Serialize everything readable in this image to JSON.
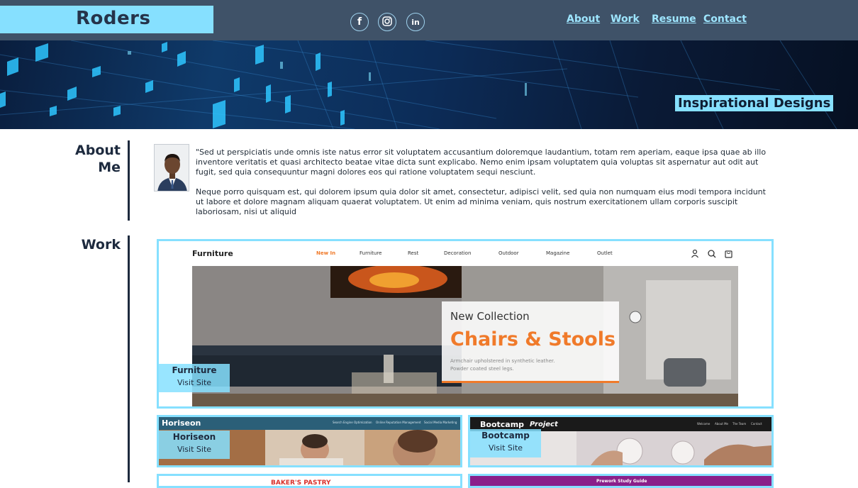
{
  "header": {
    "brand": "Roders",
    "social": [
      {
        "icon": "facebook-icon",
        "glyph": "f"
      },
      {
        "icon": "instagram-icon",
        "glyph": "◎"
      },
      {
        "icon": "linkedin-icon",
        "glyph": "in"
      }
    ],
    "nav": [
      "About",
      "Work",
      "Resume",
      "Contact"
    ]
  },
  "hero": {
    "tagline": "Inspirational Designs"
  },
  "about": {
    "title_line1": "About",
    "title_line2": "Me",
    "paragraph1": "\"Sed ut perspiciatis unde omnis iste natus error sit voluptatem accusantium doloremque laudantium, totam rem aperiam, eaque ipsa quae ab illo inventore veritatis et quasi architecto beatae vitae dicta sunt explicabo. Nemo enim ipsam voluptatem quia voluptas sit aspernatur aut odit aut fugit, sed quia consequuntur magni dolores eos qui ratione voluptatem sequi nesciunt.",
    "paragraph2": "Neque porro quisquam est, qui dolorem ipsum quia dolor sit amet, consectetur, adipisci velit, sed quia non numquam eius modi tempora incidunt ut labore et dolore magnam aliquam quaerat voluptatem. Ut enim ad minima veniam, quis nostrum exercitationem ullam corporis suscipit laboriosam, nisi ut aliquid"
  },
  "work": {
    "title": "Work",
    "visit_label": "Visit Site",
    "furniture": {
      "name": "Furniture",
      "shot": {
        "logo": "Furniture",
        "nav": [
          "New In",
          "Furniture",
          "Rest",
          "Decoration",
          "Outdoor",
          "Magazine",
          "Outlet"
        ],
        "kicker": "New Collection",
        "headline": "Chairs & Stools",
        "sub1": "Armchair upholstered in synthetic leather.",
        "sub2": "Powder coated steel legs."
      }
    },
    "horiseon": {
      "name": "Horiseon",
      "shot": {
        "logo": "Horiseon",
        "nav": [
          "Search Engine Optimization",
          "Online Reputation Management",
          "Social Media Marketing"
        ]
      }
    },
    "bootcamp": {
      "name": "Bootcamp",
      "shot": {
        "logo_a": "Bootcamp",
        "logo_b": "Project",
        "nav": [
          "Welcome",
          "About Me",
          "The Team",
          "Contact"
        ]
      }
    },
    "bottom_left_text": "BAKER'S PASTRY",
    "bottom_right_text": "Prework Study Guide"
  },
  "colors": {
    "header_bg": "#3f5268",
    "accent": "#86e0ff",
    "text_dark": "#1d2a3e",
    "orange": "#f07a2a"
  }
}
